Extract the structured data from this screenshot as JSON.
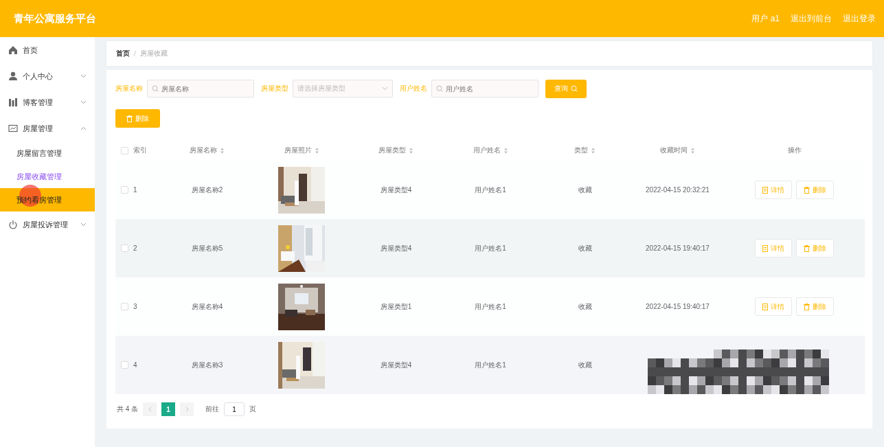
{
  "header": {
    "title": "青年公寓服务平台",
    "links": [
      "用户 a1",
      "退出到前台",
      "退出登录"
    ]
  },
  "sidebar": {
    "items": [
      {
        "label": "首页"
      },
      {
        "label": "个人中心",
        "expanded": false
      },
      {
        "label": "博客管理",
        "expanded": false
      },
      {
        "label": "房屋管理",
        "expanded": true,
        "children": [
          {
            "label": "房屋留言管理",
            "selected": false,
            "visited": false
          },
          {
            "label": "房屋收藏管理",
            "selected": false,
            "visited": true
          },
          {
            "label": "预约看房管理",
            "selected": true,
            "visited": false
          }
        ]
      },
      {
        "label": "房屋投诉管理",
        "expanded": false
      }
    ]
  },
  "breadcrumb": {
    "items": [
      "首页",
      "房屋收藏"
    ],
    "separator": "/"
  },
  "search": {
    "fields": [
      {
        "kind": "input",
        "label": "房屋名称",
        "placeholder": "房屋名称"
      },
      {
        "kind": "select",
        "label": "房屋类型",
        "placeholder": "请选择房屋类型"
      },
      {
        "kind": "input",
        "label": "用户姓名",
        "placeholder": "用户姓名"
      }
    ],
    "button": "查询"
  },
  "bulk_delete": "删除",
  "table": {
    "all_checked": false,
    "columns": [
      {
        "label": "索引",
        "sortable": false
      },
      {
        "label": "房屋名称",
        "sortable": true
      },
      {
        "label": "房屋照片",
        "sortable": true
      },
      {
        "label": "房屋类型",
        "sortable": true
      },
      {
        "label": "用户姓名",
        "sortable": true
      },
      {
        "label": "类型",
        "sortable": true
      },
      {
        "label": "收藏时间",
        "sortable": true
      },
      {
        "label": "操作",
        "sortable": false
      }
    ],
    "rows": [
      {
        "checked": false,
        "index": "1",
        "name": "房屋名称2",
        "photo": {
          "kind": "picture"
        },
        "type": "房屋类型4",
        "user": "用户姓名1",
        "kind": "收藏",
        "time": "2022-04-15 20:32:21",
        "actions": [
          "详情",
          "删除"
        ],
        "redacted": false
      },
      {
        "checked": false,
        "index": "2",
        "name": "房屋名称5",
        "photo": {
          "kind": "picture"
        },
        "type": "房屋类型4",
        "user": "用户姓名1",
        "kind": "收藏",
        "time": "2022-04-15 19:40:17",
        "actions": [
          "详情",
          "删除"
        ],
        "redacted": false
      },
      {
        "checked": false,
        "index": "3",
        "name": "房屋名称4",
        "photo": {
          "kind": "picture"
        },
        "type": "房屋类型1",
        "user": "用户姓名1",
        "kind": "收藏",
        "time": "2022-04-15 19:40:17",
        "actions": [
          "详情",
          "删除"
        ],
        "redacted": false
      },
      {
        "checked": false,
        "index": "4",
        "name": "房屋名称3",
        "photo": {
          "kind": "picture"
        },
        "type": "房屋类型4",
        "user": "用户姓名1",
        "kind": "收藏",
        "redacted": true
      }
    ]
  },
  "pager": {
    "total": "共 4 条",
    "pages": [
      {
        "label": "1",
        "selected": true
      }
    ],
    "goto": "前往",
    "page_value": "1",
    "page_unit": "页"
  }
}
